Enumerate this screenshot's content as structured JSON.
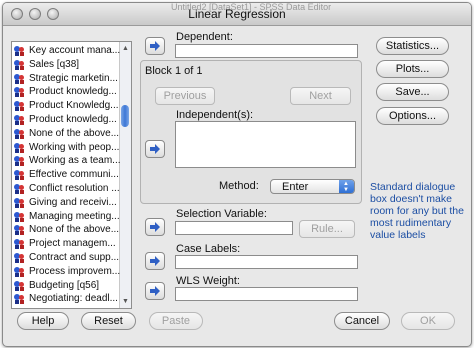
{
  "window": {
    "title": "Linear Regression",
    "ghost_title": "Untitled2 [DataSet1] - SPSS Data Editor"
  },
  "variables": [
    "Key account mana...",
    "Sales [q38]",
    "Strategic marketin...",
    "Product knowledg...",
    "Product Knowledg...",
    "Product knowledg...",
    "None of the above...",
    "Working with peop...",
    "Working as a team...",
    "Effective communi...",
    "Conflict resolution ...",
    "Giving and receivi...",
    "Managing meeting...",
    "None of the above...",
    "Project managem...",
    "Contract and supp...",
    "Process improvem...",
    "Budgeting [q56]",
    "Negotiating: deadl..."
  ],
  "fields": {
    "dependent_label": "Dependent:",
    "block_label": "Block 1 of 1",
    "previous": "Previous",
    "next": "Next",
    "independent_label": "Independent(s):",
    "method_label": "Method:",
    "method_value": "Enter",
    "selection_label": "Selection Variable:",
    "rule": "Rule...",
    "case_labels_label": "Case Labels:",
    "wls_label": "WLS Weight:"
  },
  "side_buttons": {
    "statistics": "Statistics...",
    "plots": "Plots...",
    "save": "Save...",
    "options": "Options..."
  },
  "bottom_buttons": {
    "help": "Help",
    "reset": "Reset",
    "paste": "Paste",
    "cancel": "Cancel",
    "ok": "OK"
  },
  "note": "Standard dialogue box doesn't make room for any but the most rudimentary value labels",
  "colors": {
    "note_text": "#1c4ea3",
    "accent": "#2f6fd4"
  },
  "icons": {
    "variable": "nominal-variable-icon",
    "move": "right-arrow-icon"
  }
}
